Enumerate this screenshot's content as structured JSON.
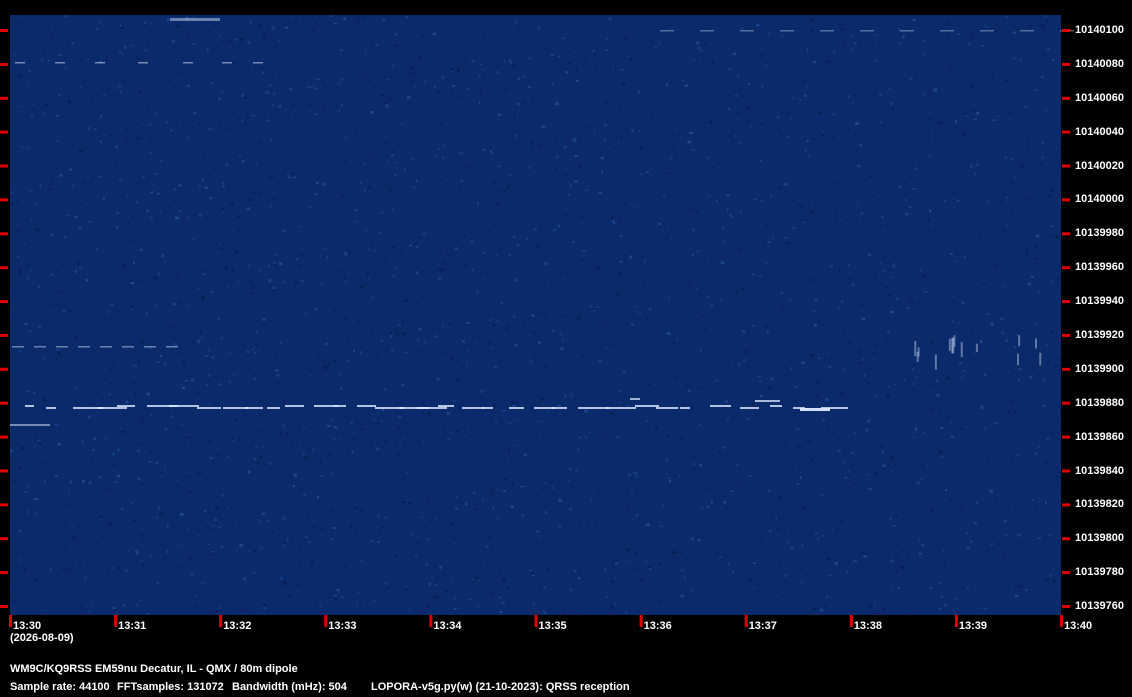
{
  "header": {
    "date": "(2026-08-09)"
  },
  "frequency_axis": {
    "labels": [
      "10140100",
      "10140080",
      "10140060",
      "10140040",
      "10140020",
      "10140000",
      "10139980",
      "10139960",
      "10139940",
      "10139920",
      "10139900",
      "10139880",
      "10139860",
      "10139840",
      "10139820",
      "10139800",
      "10139780",
      "10139760"
    ]
  },
  "time_axis": {
    "labels": [
      "13:30",
      "13:31",
      "13:32",
      "13:33",
      "13:34",
      "13:35",
      "13:36",
      "13:37",
      "13:38",
      "13:39",
      "13:40"
    ]
  },
  "footer": {
    "station": "WM9C/KQ9RSS EM59nu Decatur, IL - QMX / 80m dipole",
    "sample_rate": "Sample rate: 44100",
    "fft_samples": "FFTsamples: 131072",
    "bandwidth": "Bandwidth (mHz): 504",
    "software": "LOPORA-v5g.py(w) (21-10-2023): QRSS reception"
  },
  "colors": {
    "background": "#000000",
    "waterfall_base": "#0b2a6b",
    "signal": "#dfeaff",
    "tick": "#e00000"
  }
}
